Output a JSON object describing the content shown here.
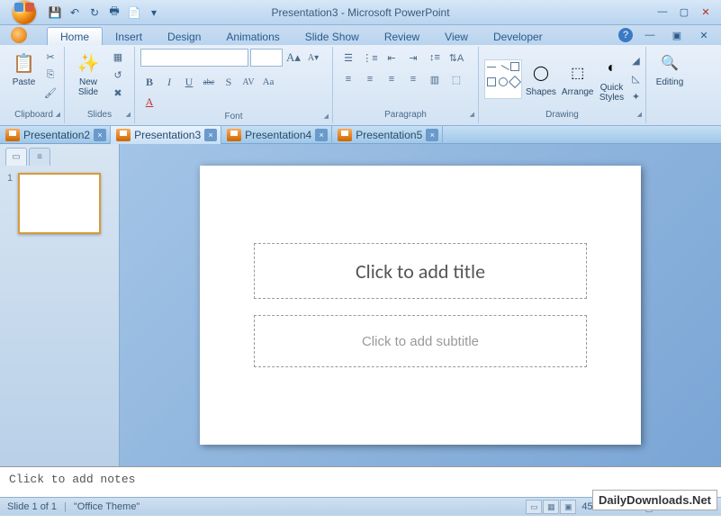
{
  "title": "Presentation3 - Microsoft PowerPoint",
  "qat": {
    "save": "💾",
    "undo": "↶",
    "redo": "↻",
    "print": "🖶",
    "new": "📄"
  },
  "ribbon_tabs": [
    "Home",
    "Insert",
    "Design",
    "Animations",
    "Slide Show",
    "Review",
    "View",
    "Developer"
  ],
  "active_tab": "Home",
  "groups": {
    "clipboard": {
      "label": "Clipboard",
      "paste": "Paste"
    },
    "slides": {
      "label": "Slides",
      "new_slide": "New\nSlide"
    },
    "font": {
      "label": "Font",
      "bold": "B",
      "italic": "I",
      "underline": "U",
      "strike": "abc",
      "shadow": "S",
      "spacing": "AV",
      "case": "Aa",
      "grow": "A",
      "shrink": "A"
    },
    "paragraph": {
      "label": "Paragraph"
    },
    "drawing": {
      "label": "Drawing",
      "shapes": "Shapes",
      "arrange": "Arrange",
      "quick": "Quick\nStyles"
    },
    "editing": {
      "label": "Editing",
      "find": "Editing"
    }
  },
  "doc_tabs": [
    "Presentation2",
    "Presentation3",
    "Presentation4",
    "Presentation5"
  ],
  "active_doc": "Presentation3",
  "slide": {
    "title_placeholder": "Click to add title",
    "subtitle_placeholder": "Click to add subtitle"
  },
  "notes_placeholder": "Click to add notes",
  "status": {
    "slide_info": "Slide 1 of 1",
    "theme": "\"Office Theme\"",
    "zoom": "45%"
  },
  "watermark": "DailyDownloads.Net"
}
